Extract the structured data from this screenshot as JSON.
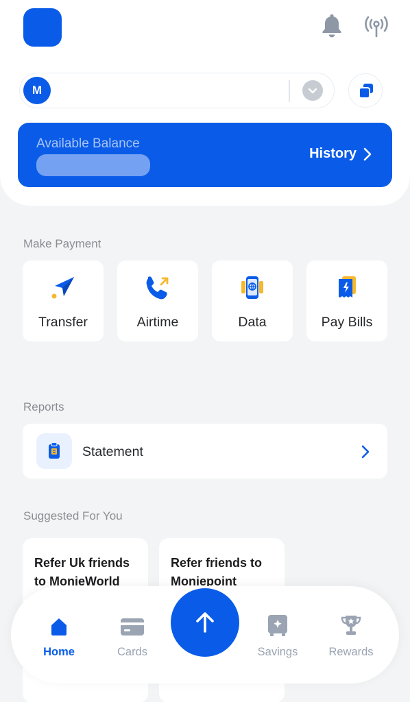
{
  "header": {
    "avatar_initial": "M",
    "icons": [
      "app-logo",
      "bell-icon",
      "signal-icon",
      "chevron-down-icon",
      "copy-icon"
    ]
  },
  "balance": {
    "label": "Available Balance",
    "history_label": "History"
  },
  "make_payment": {
    "title": "Make Payment",
    "items": [
      {
        "label": "Transfer",
        "icon": "paper-plane-icon"
      },
      {
        "label": "Airtime",
        "icon": "phone-call-icon"
      },
      {
        "label": "Data",
        "icon": "mobile-data-icon"
      },
      {
        "label": "Pay Bills",
        "icon": "bill-receipt-icon"
      }
    ]
  },
  "reports": {
    "title": "Reports",
    "statement_label": "Statement"
  },
  "suggested": {
    "title": "Suggested For You",
    "cards": [
      {
        "text": "Refer Uk friends to MonieWorld"
      },
      {
        "text": "Refer friends to Moniepoint"
      }
    ]
  },
  "nav": {
    "items": [
      {
        "label": "Home",
        "icon": "home-icon",
        "active": true
      },
      {
        "label": "Cards",
        "icon": "card-icon",
        "active": false
      },
      {
        "label": "Savings",
        "icon": "safe-icon",
        "active": false
      },
      {
        "label": "Rewards",
        "icon": "trophy-icon",
        "active": false
      }
    ],
    "fab_icon": "arrow-up-icon"
  },
  "colors": {
    "primary": "#0a5ce8",
    "background": "#f3f4f5",
    "accent_yellow": "#f5b82e",
    "nav_inactive": "#9aa4b2"
  }
}
